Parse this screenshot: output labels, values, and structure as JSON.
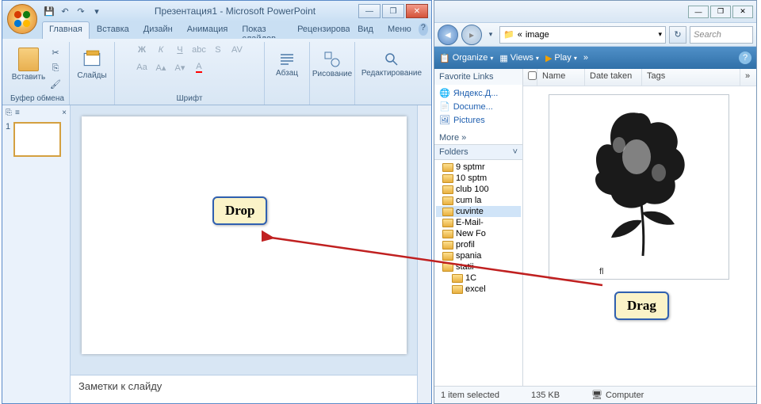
{
  "powerpoint": {
    "title": "Презентация1 - Microsoft PowerPoint",
    "qat": {
      "save": "💾",
      "undo": "↶",
      "redo": "↷",
      "dd": "▾"
    },
    "win": {
      "min": "—",
      "max": "❐",
      "close": "✕"
    },
    "tabs": [
      "Главная",
      "Вставка",
      "Дизайн",
      "Анимация",
      "Показ слайдов",
      "Рецензирование",
      "Вид",
      "Меню"
    ],
    "help": "?",
    "ribbon": {
      "clipboard": {
        "paste": "Вставить",
        "label": "Буфер обмена"
      },
      "slides": {
        "btn": "Слайды",
        "label": ""
      },
      "font": {
        "label": "Шрифт"
      },
      "para": {
        "btn": "Абзац"
      },
      "drawing": {
        "btn": "Рисование"
      },
      "editing": {
        "btn": "Редактирование"
      }
    },
    "outline": {
      "tab1": "⎘",
      "tab2": "≡",
      "close": "×",
      "num": "1"
    },
    "notes": "Заметки к слайду"
  },
  "explorer": {
    "win": {
      "min": "—",
      "max": "❐",
      "close": "✕"
    },
    "nav": {
      "back": "◄",
      "fwd": "▸",
      "dd": "▾",
      "crumbs": [
        "«",
        "image"
      ],
      "refresh": "↻",
      "srchdd": "▾"
    },
    "search_ph": "Search",
    "toolbar": {
      "organize": "Organize",
      "views": "Views",
      "play": "Play",
      "more": "»",
      "help": "?"
    },
    "favorites": {
      "header": "Favorite Links",
      "items": [
        "Яндекс.Д...",
        "Docume...",
        "Pictures"
      ],
      "more": "More »"
    },
    "folders": {
      "header": "Folders",
      "chev": "˅",
      "nodes": [
        "9 sptmr",
        "10 sptm",
        "club 100",
        "cum la",
        "cuvinte",
        "E-Mail-",
        "New Fo",
        "profil",
        "spania",
        "statii"
      ],
      "sub": [
        "1C",
        "excel"
      ]
    },
    "columns": {
      "name": "Name",
      "date": "Date taken",
      "tags": "Tags",
      "more": "»"
    },
    "item_caption": "fl",
    "status": {
      "sel": "1 item selected",
      "size": "135 KB",
      "loc": "Computer"
    }
  },
  "callouts": {
    "drop": "Drop",
    "drag": "Drag"
  }
}
